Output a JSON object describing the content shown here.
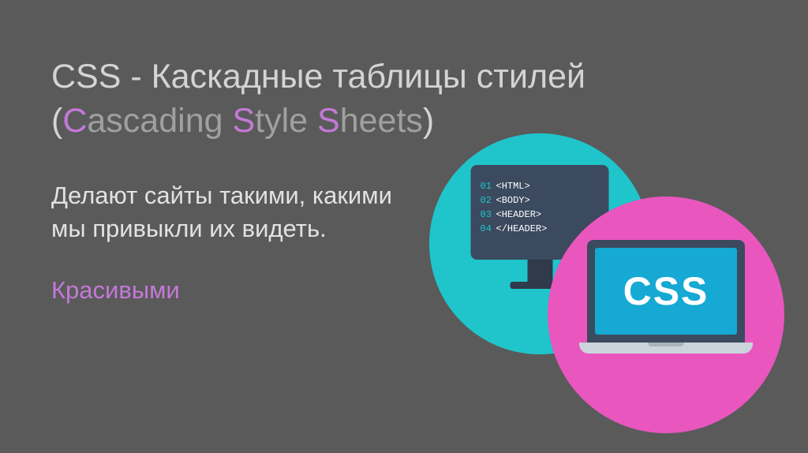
{
  "title": {
    "line1": "CSS - Каскадные таблицы стилей",
    "paren_open": "(",
    "c": "C",
    "c_rest": "ascading ",
    "s1": "S",
    "s1_rest": "tyle ",
    "s2": "S",
    "s2_rest": "heets",
    "paren_close": ")"
  },
  "subtitle": "Делают сайты такими, какими мы привыкли их видеть.",
  "accent": "Красивыми",
  "monitor_code": {
    "l1_num": "01",
    "l1_tag": "<HTML>",
    "l2_num": "02",
    "l2_tag": "<BODY>",
    "l3_num": "03",
    "l3_tag": "<HEADER>",
    "l4_num": "04",
    "l4_tag": "</HEADER>"
  },
  "laptop_label": "CSS"
}
